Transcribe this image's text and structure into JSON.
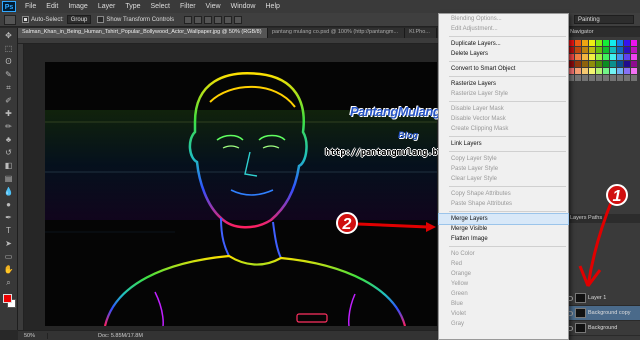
{
  "app": {
    "logo": "Ps"
  },
  "menu": [
    "File",
    "Edit",
    "Image",
    "Layer",
    "Type",
    "Select",
    "Filter",
    "View",
    "Window",
    "Help"
  ],
  "options": {
    "auto_select_label": "Auto-Select:",
    "auto_select_value": "Group",
    "transform_label": "Show Transform Controls",
    "workspace": "Painting"
  },
  "tabs": [
    {
      "label": "Salman_Khan_in_Being_Human_Tshirt_Popular_Bollywood_Actor_Wallpaper.jpg @ 50% (RGB/8)",
      "active": true
    },
    {
      "label": "pantang mulang co.psd @ 100% (http://pantangm...",
      "active": false
    },
    {
      "label": "Kl.Pho...",
      "active": false
    }
  ],
  "status": {
    "zoom": "50%",
    "doc": "Doc: 5.85M/17.8M"
  },
  "panels": {
    "swatches_title": "Navigator",
    "layers_tabs": "Layers  Paths"
  },
  "layers": [
    {
      "name": "Layer 1",
      "selected": false
    },
    {
      "name": "Background copy",
      "selected": true
    },
    {
      "name": "Background",
      "selected": false
    }
  ],
  "context_menu": [
    {
      "label": "Blending Options...",
      "disabled": true
    },
    {
      "label": "Edit Adjustment...",
      "disabled": true
    },
    {
      "sep": true
    },
    {
      "label": "Duplicate Layers...",
      "disabled": false
    },
    {
      "label": "Delete Layers",
      "disabled": false
    },
    {
      "sep": true
    },
    {
      "label": "Convert to Smart Object",
      "disabled": false
    },
    {
      "sep": true
    },
    {
      "label": "Rasterize Layers",
      "disabled": false
    },
    {
      "label": "Rasterize Layer Style",
      "disabled": true
    },
    {
      "sep": true
    },
    {
      "label": "Disable Layer Mask",
      "disabled": true
    },
    {
      "label": "Disable Vector Mask",
      "disabled": true
    },
    {
      "label": "Create Clipping Mask",
      "disabled": true
    },
    {
      "sep": true
    },
    {
      "label": "Link Layers",
      "disabled": false
    },
    {
      "sep": true
    },
    {
      "label": "Copy Layer Style",
      "disabled": true
    },
    {
      "label": "Paste Layer Style",
      "disabled": true
    },
    {
      "label": "Clear Layer Style",
      "disabled": true
    },
    {
      "sep": true
    },
    {
      "label": "Copy Shape Attributes",
      "disabled": true
    },
    {
      "label": "Paste Shape Attributes",
      "disabled": true
    },
    {
      "sep": true
    },
    {
      "label": "Merge Layers",
      "disabled": false,
      "highlighted": true
    },
    {
      "label": "Merge Visible",
      "disabled": false
    },
    {
      "label": "Flatten Image",
      "disabled": false
    },
    {
      "sep": true
    },
    {
      "label": "No Color",
      "disabled": true
    },
    {
      "label": "Red",
      "disabled": true
    },
    {
      "label": "Orange",
      "disabled": true
    },
    {
      "label": "Yellow",
      "disabled": true
    },
    {
      "label": "Green",
      "disabled": true
    },
    {
      "label": "Blue",
      "disabled": true
    },
    {
      "label": "Violet",
      "disabled": true
    },
    {
      "label": "Gray",
      "disabled": true
    }
  ],
  "overlay": {
    "blog_title": "PantangMulang",
    "blog_sub": "Blog",
    "blog_url": "http://pantangmulang.blogspot.com",
    "badge1": "1",
    "badge2": "2",
    "arrow_color": "#e00000"
  }
}
